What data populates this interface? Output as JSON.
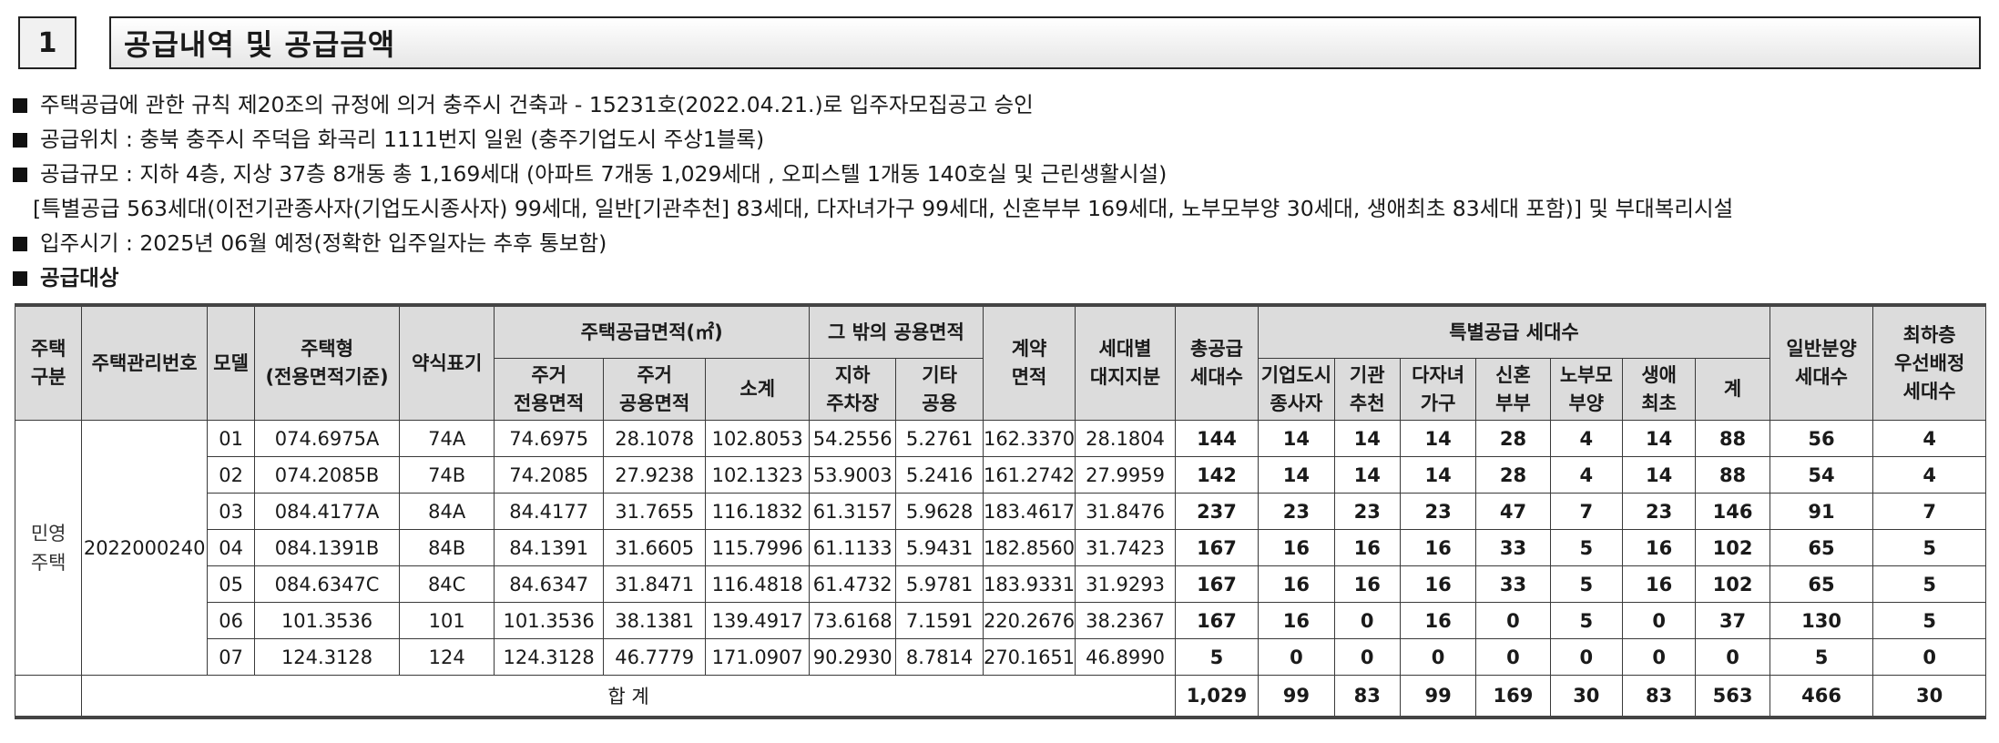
{
  "header": {
    "number": "1",
    "title": "공급내역 및 공급금액"
  },
  "bullets": [
    "주택공급에 관한 규칙 제20조의 규정에 의거 충주시 건축과 - 15231호(2022.04.21.)로 입주자모집공고 승인",
    "공급위치 : 충북 충주시 주덕읍 화곡리 1111번지 일원 (충주기업도시 주상1블록)",
    "공급규모 : 지하 4층, 지상 37층 8개동 총 1,169세대 (아파트 7개동 1,029세대 , 오피스텔 1개동 140호실 및 근린생활시설)",
    "[특별공급 563세대(이전기관종사자(기업도시종사자) 99세대, 일반[기관추천] 83세대, 다자녀가구 99세대, 신혼부부 169세대, 노부모부양 30세대, 생애최초 83세대 포함)] 및 부대복리시설",
    "입주시기 : 2025년 06월 예정(정확한 입주일자는 추후 통보함)",
    "공급대상"
  ],
  "table": {
    "headers": {
      "house_type_group_l1": "주택",
      "house_type_group_l2": "구분",
      "mgmt_no": "주택관리번호",
      "model": "모델",
      "house_type_l1": "주택형",
      "house_type_l2": "(전용면적기준)",
      "short_label": "약식표기",
      "supply_area": "주택공급면적(㎡)",
      "excl_area_l1": "주거",
      "excl_area_l2": "전용면적",
      "common_area_l1": "주거",
      "common_area_l2": "공용면적",
      "subtotal": "소계",
      "other_common": "그 밖의 공용면적",
      "parking_l1": "지하",
      "parking_l2": "주차장",
      "etc_common_l1": "기타",
      "etc_common_l2": "공용",
      "contract_area_l1": "계약",
      "contract_area_l2": "면적",
      "land_share_l1": "세대별",
      "land_share_l2": "대지지분",
      "total_units_l1": "총공급",
      "total_units_l2": "세대수",
      "special_supply": "특별공급 세대수",
      "sp_company_l1": "기업도시",
      "sp_company_l2": "종사자",
      "sp_agency_l1": "기관",
      "sp_agency_l2": "추천",
      "sp_multichild_l1": "다자녀",
      "sp_multichild_l2": "가구",
      "sp_newlywed_l1": "신혼",
      "sp_newlywed_l2": "부부",
      "sp_elderly_l1": "노부모",
      "sp_elderly_l2": "부양",
      "sp_firsttime_l1": "생애",
      "sp_firsttime_l2": "최초",
      "sp_sum": "계",
      "general_l1": "일반분양",
      "general_l2": "세대수",
      "lowest_floor_l1": "최하층",
      "lowest_floor_l2": "우선배정",
      "lowest_floor_l3": "세대수"
    },
    "house_type_group_l1": "민영",
    "house_type_group_l2": "주택",
    "mgmt_no": "2022000240",
    "rows": [
      {
        "model": "01",
        "type": "074.6975A",
        "short": "74A",
        "excl": "74.6975",
        "common": "28.1078",
        "subtotal": "102.8053",
        "parking": "54.2556",
        "etc": "5.2761",
        "contract": "162.3370",
        "land": "28.1804",
        "total": "144",
        "company": "14",
        "agency": "14",
        "multichild": "14",
        "newlywed": "28",
        "elderly": "4",
        "firsttime": "14",
        "sp_sum": "88",
        "general": "56",
        "lowest": "4"
      },
      {
        "model": "02",
        "type": "074.2085B",
        "short": "74B",
        "excl": "74.2085",
        "common": "27.9238",
        "subtotal": "102.1323",
        "parking": "53.9003",
        "etc": "5.2416",
        "contract": "161.2742",
        "land": "27.9959",
        "total": "142",
        "company": "14",
        "agency": "14",
        "multichild": "14",
        "newlywed": "28",
        "elderly": "4",
        "firsttime": "14",
        "sp_sum": "88",
        "general": "54",
        "lowest": "4"
      },
      {
        "model": "03",
        "type": "084.4177A",
        "short": "84A",
        "excl": "84.4177",
        "common": "31.7655",
        "subtotal": "116.1832",
        "parking": "61.3157",
        "etc": "5.9628",
        "contract": "183.4617",
        "land": "31.8476",
        "total": "237",
        "company": "23",
        "agency": "23",
        "multichild": "23",
        "newlywed": "47",
        "elderly": "7",
        "firsttime": "23",
        "sp_sum": "146",
        "general": "91",
        "lowest": "7"
      },
      {
        "model": "04",
        "type": "084.1391B",
        "short": "84B",
        "excl": "84.1391",
        "common": "31.6605",
        "subtotal": "115.7996",
        "parking": "61.1133",
        "etc": "5.9431",
        "contract": "182.8560",
        "land": "31.7423",
        "total": "167",
        "company": "16",
        "agency": "16",
        "multichild": "16",
        "newlywed": "33",
        "elderly": "5",
        "firsttime": "16",
        "sp_sum": "102",
        "general": "65",
        "lowest": "5"
      },
      {
        "model": "05",
        "type": "084.6347C",
        "short": "84C",
        "excl": "84.6347",
        "common": "31.8471",
        "subtotal": "116.4818",
        "parking": "61.4732",
        "etc": "5.9781",
        "contract": "183.9331",
        "land": "31.9293",
        "total": "167",
        "company": "16",
        "agency": "16",
        "multichild": "16",
        "newlywed": "33",
        "elderly": "5",
        "firsttime": "16",
        "sp_sum": "102",
        "general": "65",
        "lowest": "5"
      },
      {
        "model": "06",
        "type": "101.3536",
        "short": "101",
        "excl": "101.3536",
        "common": "38.1381",
        "subtotal": "139.4917",
        "parking": "73.6168",
        "etc": "7.1591",
        "contract": "220.2676",
        "land": "38.2367",
        "total": "167",
        "company": "16",
        "agency": "0",
        "multichild": "16",
        "newlywed": "0",
        "elderly": "5",
        "firsttime": "0",
        "sp_sum": "37",
        "general": "130",
        "lowest": "5"
      },
      {
        "model": "07",
        "type": "124.3128",
        "short": "124",
        "excl": "124.3128",
        "common": "46.7779",
        "subtotal": "171.0907",
        "parking": "90.2930",
        "etc": "8.7814",
        "contract": "270.1651",
        "land": "46.8990",
        "total": "5",
        "company": "0",
        "agency": "0",
        "multichild": "0",
        "newlywed": "0",
        "elderly": "0",
        "firsttime": "0",
        "sp_sum": "0",
        "general": "5",
        "lowest": "0"
      }
    ],
    "total_row": {
      "label": "합 계",
      "total": "1,029",
      "company": "99",
      "agency": "83",
      "multichild": "99",
      "newlywed": "169",
      "elderly": "30",
      "firsttime": "83",
      "sp_sum": "563",
      "general": "466",
      "lowest": "30"
    }
  }
}
